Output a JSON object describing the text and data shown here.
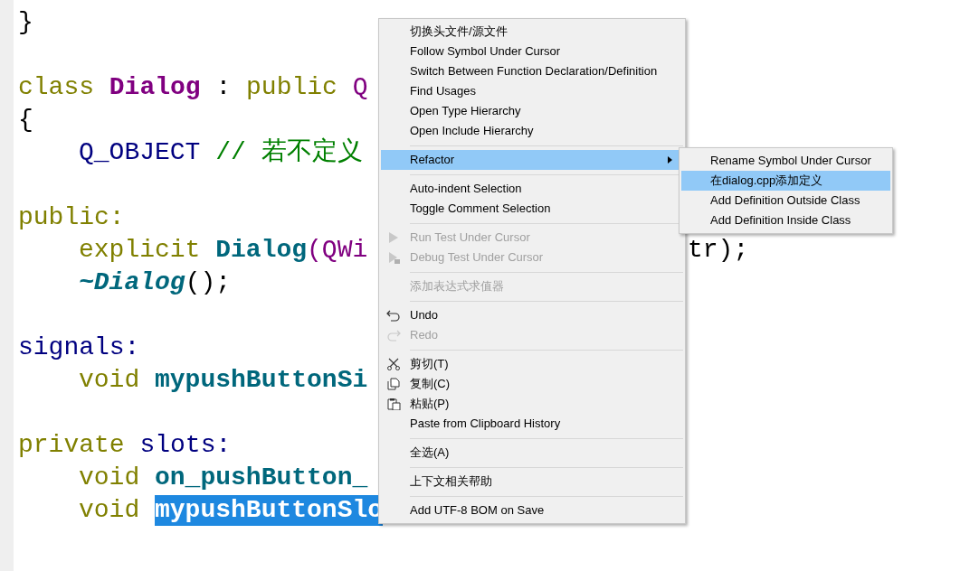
{
  "editor": {
    "lines": [
      {
        "kind": "code",
        "indented": false,
        "tokens": [
          {
            "kind": "plain",
            "text": "}"
          }
        ]
      },
      {
        "kind": "blank"
      },
      {
        "kind": "code",
        "indented": false,
        "tokens": [
          {
            "kind": "keyword",
            "text": "class"
          },
          {
            "kind": "typename",
            "text": "Dialog"
          },
          {
            "kind": "plain",
            "text": ":"
          },
          {
            "kind": "keyword",
            "text": "public"
          },
          {
            "kind": "qtype",
            "text": "Q"
          }
        ]
      },
      {
        "kind": "code",
        "indented": false,
        "tokens": [
          {
            "kind": "plain",
            "text": "{"
          }
        ]
      },
      {
        "kind": "code",
        "indented": true,
        "tokens": [
          {
            "kind": "macro",
            "text": "Q_OBJECT"
          },
          {
            "kind": "comment",
            "text": "// 若不定义"
          }
        ]
      },
      {
        "kind": "blank"
      },
      {
        "kind": "code",
        "indented": false,
        "tokens": [
          {
            "kind": "keyword",
            "text": "public:"
          }
        ]
      },
      {
        "kind": "code",
        "indented": true,
        "tokens": [
          {
            "kind": "keyword",
            "text": "explicit"
          },
          {
            "kind": "function",
            "text": "Dialog"
          },
          {
            "kind": "qtype",
            "text": "(QWi",
            "attached": true
          }
        ],
        "right_tokens": [
          {
            "kind": "plain",
            "text": "tr);"
          }
        ]
      },
      {
        "kind": "code",
        "indented": true,
        "tokens": [
          {
            "kind": "function-italic",
            "text": "~Dialog"
          },
          {
            "kind": "plain",
            "text": "();",
            "attached": true
          }
        ]
      },
      {
        "kind": "blank"
      },
      {
        "kind": "code",
        "indented": false,
        "tokens": [
          {
            "kind": "access",
            "text": "signals:"
          }
        ]
      },
      {
        "kind": "code",
        "indented": true,
        "tokens": [
          {
            "kind": "keyword",
            "text": "void"
          },
          {
            "kind": "function",
            "text": "mypushButtonSi"
          }
        ]
      },
      {
        "kind": "blank"
      },
      {
        "kind": "code",
        "indented": false,
        "tokens": [
          {
            "kind": "keyword",
            "text": "private"
          },
          {
            "kind": "access",
            "text": "slots:"
          }
        ]
      },
      {
        "kind": "code",
        "indented": true,
        "tokens": [
          {
            "kind": "keyword",
            "text": "void"
          },
          {
            "kind": "function",
            "text": "on_pushButton_"
          }
        ]
      },
      {
        "kind": "code",
        "indented": true,
        "tokens": [
          {
            "kind": "keyword",
            "text": "void"
          },
          {
            "kind": "selected",
            "text": "mypushButtonSlo"
          }
        ]
      }
    ]
  },
  "context_menu": {
    "items": [
      {
        "kind": "item",
        "label": "切换头文件/源文件",
        "disabled": false,
        "selected": false
      },
      {
        "kind": "item",
        "label": "Follow Symbol Under Cursor",
        "disabled": false,
        "selected": false
      },
      {
        "kind": "item",
        "label": "Switch Between Function Declaration/Definition",
        "disabled": false,
        "selected": false
      },
      {
        "kind": "item",
        "label": "Find Usages",
        "disabled": false,
        "selected": false
      },
      {
        "kind": "item",
        "label": "Open Type Hierarchy",
        "disabled": false,
        "selected": false
      },
      {
        "kind": "item",
        "label": "Open Include Hierarchy",
        "disabled": false,
        "selected": false
      },
      {
        "kind": "separator"
      },
      {
        "kind": "submenu",
        "label": "Refactor",
        "disabled": false,
        "selected": true
      },
      {
        "kind": "separator"
      },
      {
        "kind": "item",
        "label": "Auto-indent Selection",
        "disabled": false,
        "selected": false
      },
      {
        "kind": "item",
        "label": "Toggle Comment Selection",
        "disabled": false,
        "selected": false
      },
      {
        "kind": "separator"
      },
      {
        "kind": "item",
        "label": "Run Test Under Cursor",
        "disabled": true,
        "selected": false
      },
      {
        "kind": "item",
        "label": "Debug Test Under Cursor",
        "disabled": true,
        "selected": false
      },
      {
        "kind": "separator"
      },
      {
        "kind": "item",
        "label": "添加表达式求值器",
        "disabled": true,
        "selected": false
      },
      {
        "kind": "separator"
      },
      {
        "kind": "item",
        "label": "Undo",
        "disabled": false,
        "selected": false
      },
      {
        "kind": "item",
        "label": "Redo",
        "disabled": true,
        "selected": false
      },
      {
        "kind": "separator"
      },
      {
        "kind": "item",
        "label": "剪切(T)",
        "disabled": false,
        "selected": false
      },
      {
        "kind": "item",
        "label": "复制(C)",
        "disabled": false,
        "selected": false
      },
      {
        "kind": "item",
        "label": "粘贴(P)",
        "disabled": false,
        "selected": false
      },
      {
        "kind": "item",
        "label": "Paste from Clipboard History",
        "disabled": false,
        "selected": false
      },
      {
        "kind": "separator"
      },
      {
        "kind": "item",
        "label": "全选(A)",
        "disabled": false,
        "selected": false
      },
      {
        "kind": "separator"
      },
      {
        "kind": "item",
        "label": "上下文相关帮助",
        "disabled": false,
        "selected": false
      },
      {
        "kind": "separator"
      },
      {
        "kind": "item",
        "label": "Add UTF-8 BOM on Save",
        "disabled": false,
        "selected": false
      }
    ]
  },
  "submenu": {
    "items": [
      {
        "label": "Rename Symbol Under Cursor",
        "selected": false
      },
      {
        "label": "在dialog.cpp添加定义",
        "selected": true
      },
      {
        "label": "Add Definition Outside Class",
        "selected": false
      },
      {
        "label": "Add Definition Inside Class",
        "selected": false
      }
    ]
  }
}
